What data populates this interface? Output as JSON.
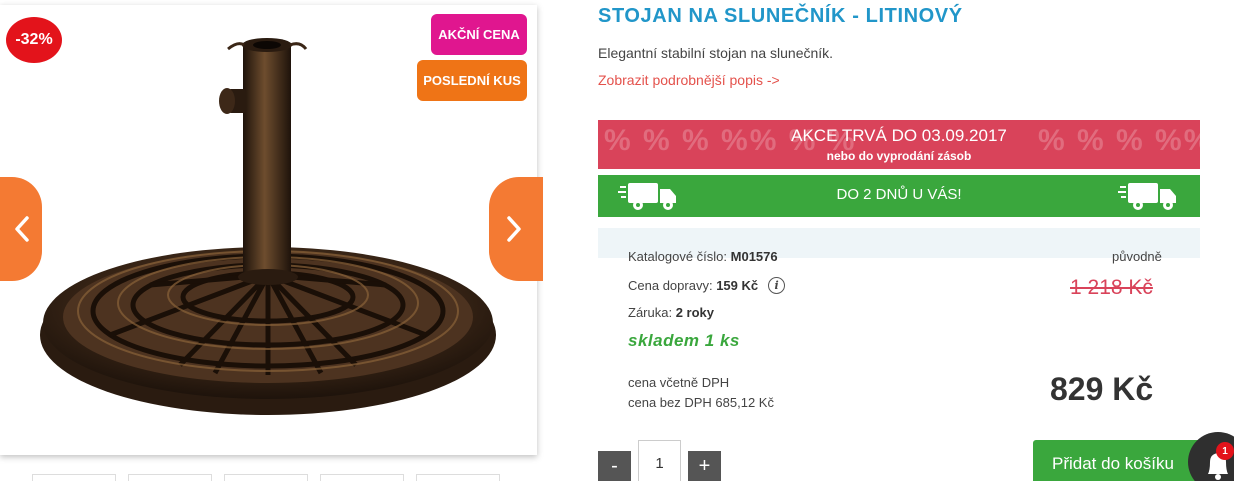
{
  "product": {
    "title": "STOJAN NA SLUNEČNÍK - LITINOVÝ",
    "short_description": "Elegantní stabilní stojan na slunečník.",
    "more_link": "Zobrazit podrobnější popis ->"
  },
  "gallery": {
    "discount_badge": "-32%",
    "labels": {
      "sale": "AKČNÍ CENA",
      "last_piece": "POSLEDNÍ KUS"
    },
    "prev_icon": "chevron-left-icon",
    "next_icon": "chevron-right-icon",
    "thumbnail_count": 5
  },
  "promo": {
    "title": "AKCE TRVÁ DO 03.09.2017",
    "subtitle": "nebo do vyprodání zásob",
    "decoration": "%  % %  %% % %"
  },
  "delivery": {
    "text": "DO 2 DNŮ U VÁS!",
    "icon": "delivery-truck-icon"
  },
  "details": {
    "catalog_label": "Katalogové číslo:",
    "catalog_value": "M01576",
    "shipping_label": "Cena dopravy:",
    "shipping_value": "159 Kč",
    "warranty_label": "Záruka:",
    "warranty_value": "2 roky",
    "stock": "skladem 1 ks"
  },
  "pricing": {
    "original_label": "původně",
    "original_price": "1 218 Kč",
    "price": "829 Kč",
    "vat_included": "cena včetně DPH",
    "vat_excluded": "cena bez DPH 685,12 Kč"
  },
  "cart": {
    "minus": "-",
    "plus": "+",
    "quantity": "1",
    "add_button": "Přidat do košíku"
  },
  "notification": {
    "count": "1",
    "icon": "bell-icon"
  },
  "colors": {
    "title_blue": "#2196c9",
    "promo_red": "#d9435a",
    "delivery_green": "#3aa73d",
    "sale_pink": "#e0168f",
    "last_piece_orange": "#ef7416",
    "arrow_orange": "#f47a33",
    "discount_red": "#e3131b"
  }
}
